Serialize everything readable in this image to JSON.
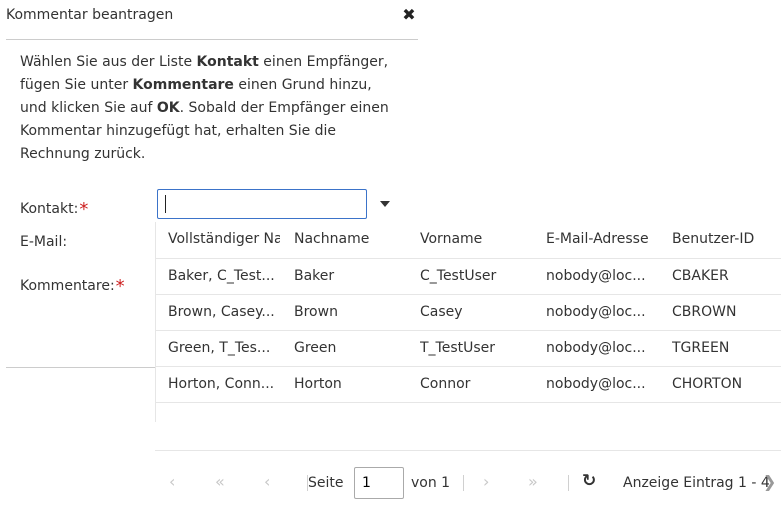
{
  "dialog": {
    "title": "Kommentar beantragen",
    "close_symbol": "✖"
  },
  "instructions": {
    "p1": "Wählen Sie aus der Liste ",
    "b1": "Kontakt",
    "p2": " einen Empfänger, fügen Sie unter ",
    "b2": "Kommentare",
    "p3": " einen Grund hinzu, und klicken Sie auf ",
    "b3": "OK",
    "p4": ". Sobald der Empfänger einen Kommentar hinzugefügt hat, erhalten Sie die Rechnung zurück."
  },
  "form": {
    "contact_label": "Kontakt:",
    "email_label": "E-Mail:",
    "comments_label": "Kommentare:",
    "required_mark": "*",
    "contact_value": ""
  },
  "grid": {
    "columns": [
      "Vollständiger Na",
      "Nachname",
      "Vorname",
      "E-Mail-Adresse",
      "Benutzer-ID"
    ],
    "rows": [
      [
        "Baker, C_Test...",
        "Baker",
        "C_TestUser",
        "nobody@loc...",
        "CBAKER"
      ],
      [
        "Brown, Casey...",
        "Brown",
        "Casey",
        "nobody@loc...",
        "CBROWN"
      ],
      [
        "Green, T_Tes...",
        "Green",
        "T_TestUser",
        "nobody@loc...",
        "TGREEN"
      ],
      [
        "Horton, Conn...",
        "Horton",
        "Connor",
        "nobody@loc...",
        "CHORTON"
      ]
    ]
  },
  "pager": {
    "page_label": "Seite",
    "page_value": "1",
    "of_label": "von 1",
    "status": "Anzeige Eintrag 1 - 4",
    "first_symbol": "«",
    "prev_symbol": "‹",
    "prev_prev_symbol": "‹",
    "next_symbol": "›",
    "last_symbol": "»",
    "refresh_symbol": "↻",
    "arrow_symbol": "❯",
    "edge_symbol": "‹"
  },
  "colors": {
    "required": "#cc1f1f",
    "focus_border": "#3b73c9"
  }
}
